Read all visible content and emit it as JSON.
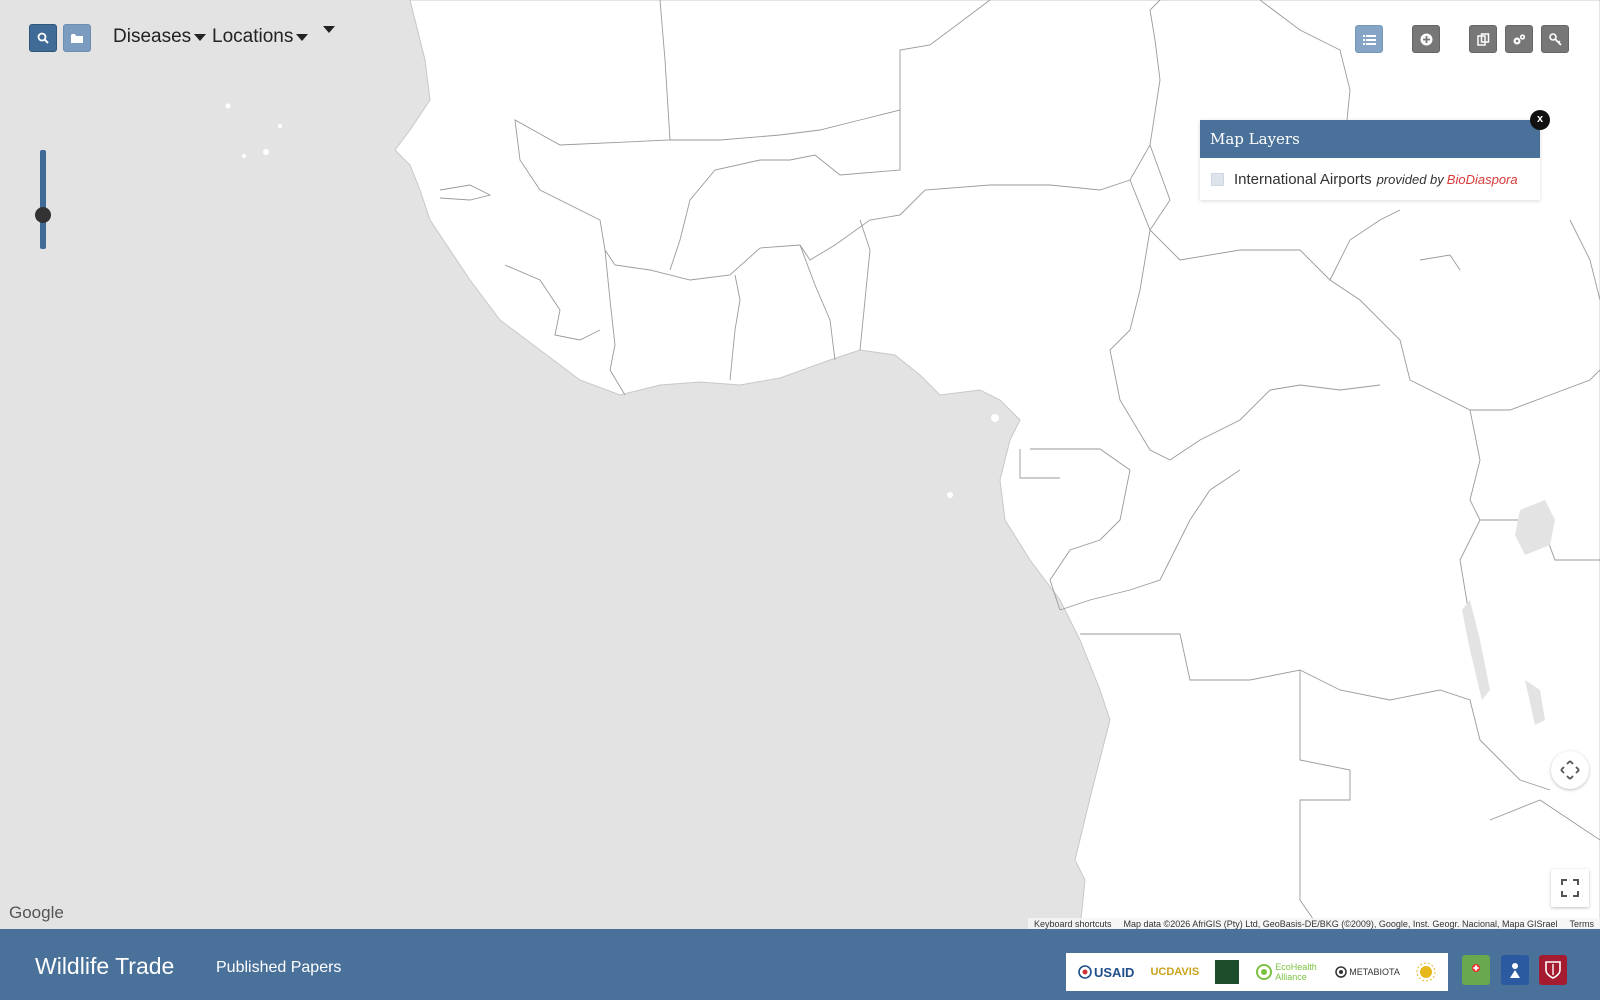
{
  "menu": {
    "diseases_label": "Diseases",
    "locations_label": "Locations"
  },
  "layers": {
    "header": "Map Layers",
    "close_label": "x",
    "items": [
      {
        "label": "International Airports",
        "provided_by": "provided by",
        "source": "BioDiaspora",
        "checked": false
      }
    ]
  },
  "map": {
    "zoom_level": 0.12,
    "google_label": "Google",
    "keyboard_shortcuts": "Keyboard shortcuts",
    "map_data": "Map data ©2026 AfriGIS (Pty) Ltd, GeoBasis-DE/BKG (©2009), Google, Inst. Geogr. Nacional, Mapa GISrael",
    "terms": "Terms"
  },
  "footer": {
    "brand": "Wildlife Trade",
    "papers_link": "Published Papers",
    "partner_logos": [
      "USAID",
      "UCDAVIS",
      "EcoHealth Alliance",
      "METABIOTA"
    ]
  },
  "colors": {
    "ocean": "#e3e3e3",
    "land": "#ffffff",
    "footer": "#4a719a",
    "accent": "#3f6b96",
    "link": "#d93a3a"
  }
}
